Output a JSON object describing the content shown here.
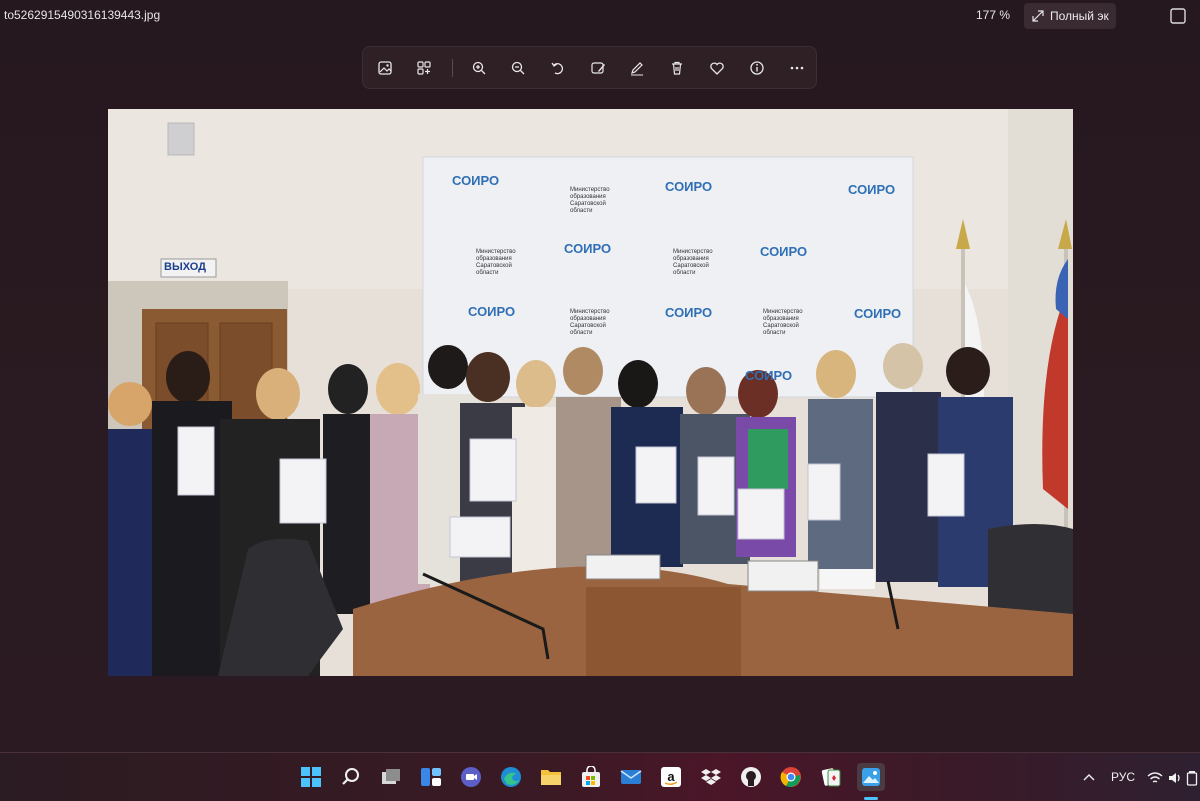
{
  "window": {
    "filename": "to5262915490316139443.jpg",
    "zoom_level": "177 %",
    "fullscreen_label": "Полный эк"
  },
  "toolbar": {
    "icons": [
      "image-icon",
      "collection-icon",
      "zoom-in-icon",
      "zoom-out-icon",
      "rotate-icon",
      "edit-image-icon",
      "draw-icon",
      "delete-icon",
      "favorite-icon",
      "info-icon",
      "more-icon"
    ]
  },
  "photo": {
    "banner_brand": "СОИРО",
    "banner_ministry": "Министерство образования Саратовской области",
    "exit_sign": "ВЫХОД"
  },
  "taskbar": {
    "apps": [
      "start-icon",
      "search-icon",
      "task-view-icon",
      "widgets-icon",
      "teams-icon",
      "edge-icon",
      "file-explorer-icon",
      "store-icon",
      "mail-icon",
      "amazon-icon",
      "dropbox-icon",
      "github-icon",
      "chrome-icon",
      "solitaire-icon",
      "photos-icon"
    ],
    "tray": {
      "language": "РУС"
    }
  },
  "colors": {
    "background": "#28181f",
    "accent": "#4a9bd8",
    "soiro_red": "#c0392b",
    "soiro_blue": "#2f6fb5"
  }
}
